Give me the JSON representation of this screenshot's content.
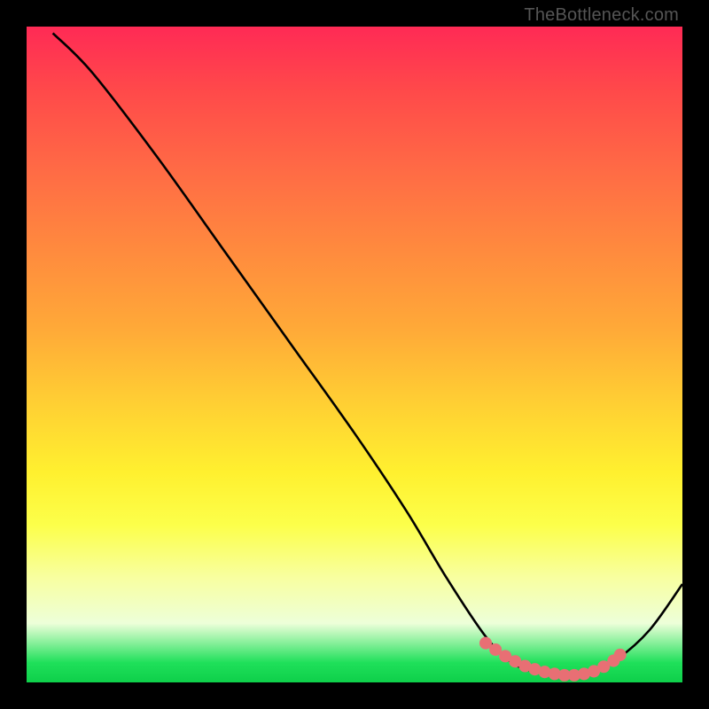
{
  "watermark": "TheBottleneck.com",
  "colors": {
    "curve": "#000000",
    "marker": "#e86f74",
    "frame_bg": "#000000"
  },
  "chart_data": {
    "type": "line",
    "title": "",
    "xlabel": "",
    "ylabel": "",
    "xlim": [
      0,
      100
    ],
    "ylim": [
      0,
      100
    ],
    "grid": false,
    "curve_xy": [
      [
        4,
        99
      ],
      [
        10,
        93
      ],
      [
        20,
        80
      ],
      [
        30,
        66
      ],
      [
        40,
        52
      ],
      [
        50,
        38
      ],
      [
        58,
        26
      ],
      [
        64,
        16
      ],
      [
        70,
        7
      ],
      [
        74,
        3
      ],
      [
        78,
        1.5
      ],
      [
        82,
        1
      ],
      [
        86,
        1.5
      ],
      [
        90,
        3.5
      ],
      [
        95,
        8
      ],
      [
        100,
        15
      ]
    ],
    "marker_region_x": [
      70,
      90
    ],
    "markers_xy": [
      [
        70.0,
        6.0
      ],
      [
        71.5,
        5.0
      ],
      [
        73.0,
        4.0
      ],
      [
        74.5,
        3.2
      ],
      [
        76.0,
        2.5
      ],
      [
        77.5,
        2.0
      ],
      [
        79.0,
        1.6
      ],
      [
        80.5,
        1.3
      ],
      [
        82.0,
        1.1
      ],
      [
        83.5,
        1.1
      ],
      [
        85.0,
        1.3
      ],
      [
        86.5,
        1.7
      ],
      [
        88.0,
        2.4
      ],
      [
        89.5,
        3.3
      ],
      [
        90.5,
        4.2
      ]
    ]
  }
}
